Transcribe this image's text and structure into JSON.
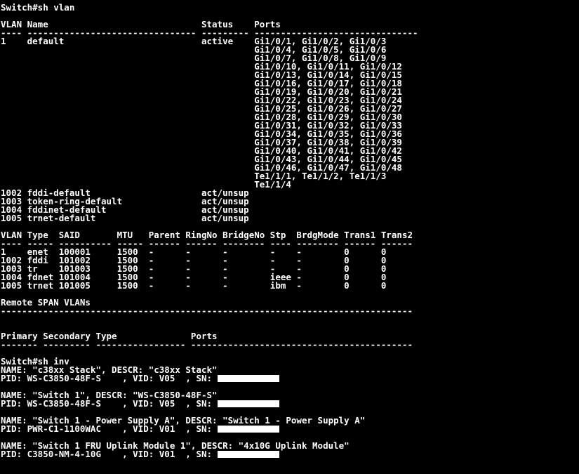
{
  "lines": [
    {
      "text": "Switch#sh vlan"
    },
    {
      "text": ""
    },
    {
      "text": "VLAN Name                             Status    Ports"
    },
    {
      "text": "---- -------------------------------- --------- -------------------------------"
    },
    {
      "text": "1    default                          active    Gi1/0/1, Gi1/0/2, Gi1/0/3"
    },
    {
      "text": "                                                Gi1/0/4, Gi1/0/5, Gi1/0/6"
    },
    {
      "text": "                                                Gi1/0/7, Gi1/0/8, Gi1/0/9"
    },
    {
      "text": "                                                Gi1/0/10, Gi1/0/11, Gi1/0/12"
    },
    {
      "text": "                                                Gi1/0/13, Gi1/0/14, Gi1/0/15"
    },
    {
      "text": "                                                Gi1/0/16, Gi1/0/17, Gi1/0/18"
    },
    {
      "text": "                                                Gi1/0/19, Gi1/0/20, Gi1/0/21"
    },
    {
      "text": "                                                Gi1/0/22, Gi1/0/23, Gi1/0/24"
    },
    {
      "text": "                                                Gi1/0/25, Gi1/0/26, Gi1/0/27"
    },
    {
      "text": "                                                Gi1/0/28, Gi1/0/29, Gi1/0/30"
    },
    {
      "text": "                                                Gi1/0/31, Gi1/0/32, Gi1/0/33"
    },
    {
      "text": "                                                Gi1/0/34, Gi1/0/35, Gi1/0/36"
    },
    {
      "text": "                                                Gi1/0/37, Gi1/0/38, Gi1/0/39"
    },
    {
      "text": "                                                Gi1/0/40, Gi1/0/41, Gi1/0/42"
    },
    {
      "text": "                                                Gi1/0/43, Gi1/0/44, Gi1/0/45"
    },
    {
      "text": "                                                Gi1/0/46, Gi1/0/47, Gi1/0/48"
    },
    {
      "text": "                                                Te1/1/1, Te1/1/2, Te1/1/3"
    },
    {
      "text": "                                                Te1/1/4"
    },
    {
      "text": "1002 fddi-default                     act/unsup"
    },
    {
      "text": "1003 token-ring-default               act/unsup"
    },
    {
      "text": "1004 fddinet-default                  act/unsup"
    },
    {
      "text": "1005 trnet-default                    act/unsup"
    },
    {
      "text": ""
    },
    {
      "text": "VLAN Type  SAID       MTU   Parent RingNo BridgeNo Stp  BrdgMode Trans1 Trans2"
    },
    {
      "text": "---- ----- ---------- ----- ------ ------ -------- ---- -------- ------ ------"
    },
    {
      "text": "1    enet  100001     1500  -      -      -        -    -        0      0"
    },
    {
      "text": "1002 fddi  101002     1500  -      -      -        -    -        0      0"
    },
    {
      "text": "1003 tr    101003     1500  -      -      -        -    -        0      0"
    },
    {
      "text": "1004 fdnet 101004     1500  -      -      -        ieee -        0      0"
    },
    {
      "text": "1005 trnet 101005     1500  -      -      -        ibm  -        0      0"
    },
    {
      "text": ""
    },
    {
      "text": "Remote SPAN VLANs"
    },
    {
      "text": "------------------------------------------------------------------------------"
    },
    {
      "text": ""
    },
    {
      "text": ""
    },
    {
      "text": "Primary Secondary Type              Ports"
    },
    {
      "text": "------- --------- ----------------- ------------------------------------------"
    },
    {
      "text": ""
    },
    {
      "text": "Switch#sh inv"
    },
    {
      "text": "NAME: \"c38xx Stack\", DESCR: \"c38xx Stack\""
    },
    {
      "text": "PID: WS-C3850-48F-S    , VID: V05  , SN: ",
      "redacted": true
    },
    {
      "text": ""
    },
    {
      "text": "NAME: \"Switch 1\", DESCR: \"WS-C3850-48F-S\""
    },
    {
      "text": "PID: WS-C3850-48F-S    , VID: V05  , SN: ",
      "redacted": true
    },
    {
      "text": ""
    },
    {
      "text": "NAME: \"Switch 1 - Power Supply A\", DESCR: \"Switch 1 - Power Supply A\""
    },
    {
      "text": "PID: PWR-C1-1100WAC    , VID: V01  , SN: ",
      "redacted": true
    },
    {
      "text": ""
    },
    {
      "text": "NAME: \"Switch 1 FRU Uplink Module 1\", DESCR: \"4x10G Uplink Module\""
    },
    {
      "text": "PID: C3850-NM-4-10G    , VID: V01  , SN: ",
      "redacted": true
    }
  ]
}
